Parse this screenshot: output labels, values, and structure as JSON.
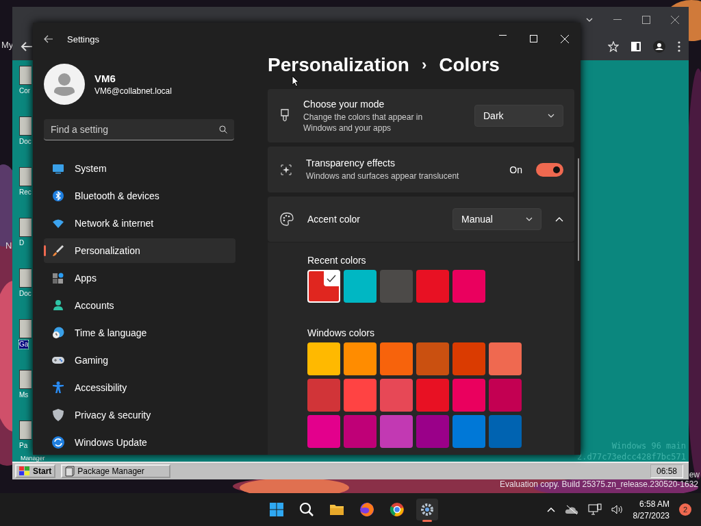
{
  "desktop_labels": [
    "My",
    "N"
  ],
  "browser": {
    "win96": {
      "icons": [
        {
          "label": "Cor",
          "selected": false
        },
        {
          "label": "Doc",
          "selected": false
        },
        {
          "label": "Rec",
          "selected": false
        },
        {
          "label": "D",
          "selected": false
        },
        {
          "label": "Doc",
          "selected": false
        },
        {
          "label": "Ga",
          "selected": true
        },
        {
          "label": "Ms",
          "selected": false
        },
        {
          "label": "Pa",
          "selected": false
        }
      ],
      "icon_caption_tail": "Manager",
      "version_lines": [
        "Windows 96 main",
        "2.d77c73edcc428f7bc571"
      ],
      "taskbar": {
        "start": "Start",
        "task": "Package Manager",
        "clock": "06:58"
      }
    }
  },
  "evaluation": {
    "cut_text": "ew",
    "build": "Evaluation copy. Build 25375.zn_release.230520-1632"
  },
  "settings": {
    "window_title": "Settings",
    "profile": {
      "name": "VM6",
      "email": "VM6@collabnet.local"
    },
    "search": {
      "placeholder": "Find a setting"
    },
    "nav": [
      {
        "label": "System",
        "selected": false
      },
      {
        "label": "Bluetooth & devices",
        "selected": false
      },
      {
        "label": "Network & internet",
        "selected": false
      },
      {
        "label": "Personalization",
        "selected": true
      },
      {
        "label": "Apps",
        "selected": false
      },
      {
        "label": "Accounts",
        "selected": false
      },
      {
        "label": "Time & language",
        "selected": false
      },
      {
        "label": "Gaming",
        "selected": false
      },
      {
        "label": "Accessibility",
        "selected": false
      },
      {
        "label": "Privacy & security",
        "selected": false
      },
      {
        "label": "Windows Update",
        "selected": false
      }
    ],
    "breadcrumb": {
      "parent": "Personalization",
      "separator": "›",
      "current": "Colors"
    },
    "mode": {
      "title": "Choose your mode",
      "description": "Change the colors that appear in Windows and your apps",
      "value": "Dark"
    },
    "transparency": {
      "title": "Transparency effects",
      "description": "Windows and surfaces appear translucent",
      "state_label": "On",
      "on": true
    },
    "accent": {
      "title": "Accent color",
      "value": "Manual",
      "expanded": true,
      "recent_title": "Recent colors",
      "recent": [
        {
          "color": "#e0261f",
          "selected": true
        },
        {
          "color": "#00b7c3",
          "selected": false
        },
        {
          "color": "#4c4a48",
          "selected": false
        },
        {
          "color": "#e81123",
          "selected": false
        },
        {
          "color": "#ea005e",
          "selected": false
        }
      ],
      "windows_title": "Windows colors",
      "windows": [
        {
          "color": "#ffb900"
        },
        {
          "color": "#ff8c00"
        },
        {
          "color": "#f7630c"
        },
        {
          "color": "#ca5010"
        },
        {
          "color": "#da3b01"
        },
        {
          "color": "#ef6950"
        },
        {
          "color": "#d13438"
        },
        {
          "color": "#ff4343"
        },
        {
          "color": "#e74856"
        },
        {
          "color": "#e81123"
        },
        {
          "color": "#ea005e"
        },
        {
          "color": "#c30052"
        },
        {
          "color": "#e3008c"
        },
        {
          "color": "#bf0077"
        },
        {
          "color": "#c239b3"
        },
        {
          "color": "#9a0089"
        },
        {
          "color": "#0078d7"
        },
        {
          "color": "#0063b1"
        }
      ]
    }
  },
  "taskbar": {
    "apps": [
      {
        "active": false
      },
      {
        "active": false
      },
      {
        "active": false
      },
      {
        "active": false
      },
      {
        "active": false
      },
      {
        "active": true
      }
    ],
    "time": "6:58 AM",
    "date": "8/27/2023",
    "badge": "2"
  }
}
